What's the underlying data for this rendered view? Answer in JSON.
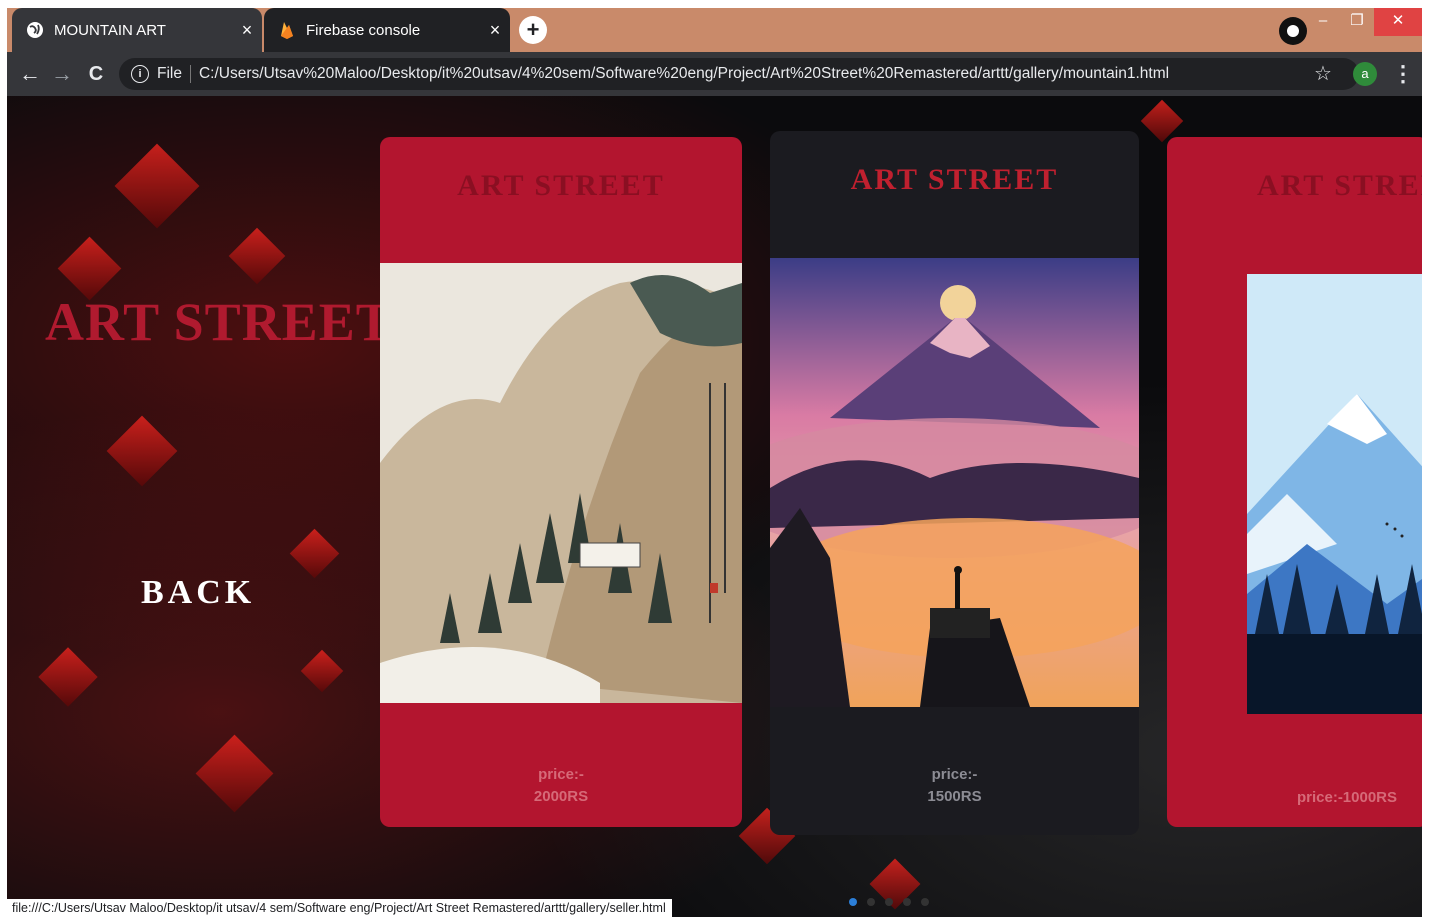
{
  "browser": {
    "tabs": [
      {
        "title": "MOUNTAIN ART",
        "close": "×"
      },
      {
        "title": "Firebase console",
        "close": "×"
      }
    ],
    "new_tab": "+",
    "window_controls": {
      "minimize": "–",
      "restore": "❐",
      "close": "✕"
    },
    "nav": {
      "back": "←",
      "forward": "→",
      "reload": "C"
    },
    "omnibox": {
      "scheme_label": "File",
      "url": "C:/Users/Utsav%20Maloo/Desktop/it%20utsav/4%20sem/Software%20eng/Project/Art%20Street%20Remastered/arttt/gallery/mountain1.html"
    },
    "profile_initial": "a",
    "status_url": "file:///C:/Users/Utsav Maloo/Desktop/it utsav/4 sem/Software eng/Project/Art Street Remastered/arttt/gallery/seller.html"
  },
  "page": {
    "hero_title": "ART STREET",
    "back_label": "BACK",
    "cards": [
      {
        "title": "ART STREET",
        "price_label": "price:-",
        "price_value": "2000RS"
      },
      {
        "title": "ART STREET",
        "price_label": "price:-",
        "price_value": "1500RS"
      },
      {
        "title": "ART STREE",
        "price_full": "price:-1000RS"
      }
    ],
    "carousel_dots": 5,
    "active_dot": 1
  },
  "colors": {
    "card_red": "#b3152f",
    "card_dark": "#1b1b20",
    "hero_red": "#b01a2f",
    "tab_strip": "#c98a6a"
  }
}
